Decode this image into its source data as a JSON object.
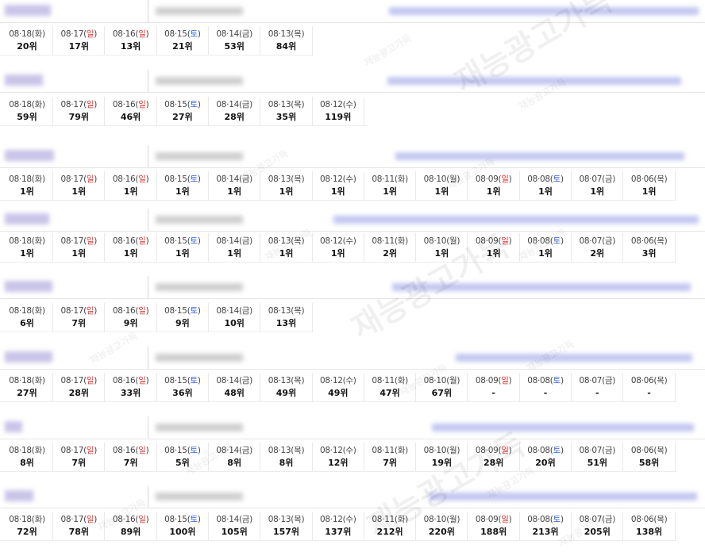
{
  "colors": {
    "sunday": "#e0302d",
    "saturday": "#2f5fd0",
    "watermark": "#bdbdbd"
  },
  "watermark_text": "재능광고가득",
  "blocks": [
    {
      "cells": [
        {
          "md": "08·18",
          "wd": "화",
          "rank": "20위"
        },
        {
          "md": "08·17",
          "wd": "일",
          "rank": "17위"
        },
        {
          "md": "08·16",
          "wd": "일",
          "rank": "13위"
        },
        {
          "md": "08·15",
          "wd": "토",
          "rank": "21위"
        },
        {
          "md": "08·14",
          "wd": "금",
          "rank": "53위"
        },
        {
          "md": "08·13",
          "wd": "목",
          "rank": "84위"
        }
      ]
    },
    {
      "cells": [
        {
          "md": "08·18",
          "wd": "화",
          "rank": "59위"
        },
        {
          "md": "08·17",
          "wd": "일",
          "rank": "79위"
        },
        {
          "md": "08·16",
          "wd": "일",
          "rank": "46위"
        },
        {
          "md": "08·15",
          "wd": "토",
          "rank": "27위"
        },
        {
          "md": "08·14",
          "wd": "금",
          "rank": "28위"
        },
        {
          "md": "08·13",
          "wd": "목",
          "rank": "35위"
        },
        {
          "md": "08·12",
          "wd": "수",
          "rank": "119위"
        }
      ]
    },
    {
      "cells": [
        {
          "md": "08·18",
          "wd": "화",
          "rank": "1위"
        },
        {
          "md": "08·17",
          "wd": "일",
          "rank": "1위"
        },
        {
          "md": "08·16",
          "wd": "일",
          "rank": "1위"
        },
        {
          "md": "08·15",
          "wd": "토",
          "rank": "1위"
        },
        {
          "md": "08·14",
          "wd": "금",
          "rank": "1위"
        },
        {
          "md": "08·13",
          "wd": "목",
          "rank": "1위"
        },
        {
          "md": "08·12",
          "wd": "수",
          "rank": "1위"
        },
        {
          "md": "08·11",
          "wd": "화",
          "rank": "1위"
        },
        {
          "md": "08·10",
          "wd": "월",
          "rank": "1위"
        },
        {
          "md": "08·09",
          "wd": "일",
          "rank": "1위"
        },
        {
          "md": "08·08",
          "wd": "토",
          "rank": "1위"
        },
        {
          "md": "08·07",
          "wd": "금",
          "rank": "1위"
        },
        {
          "md": "08·06",
          "wd": "목",
          "rank": "1위"
        }
      ]
    },
    {
      "cells": [
        {
          "md": "08·18",
          "wd": "화",
          "rank": "1위"
        },
        {
          "md": "08·17",
          "wd": "일",
          "rank": "1위"
        },
        {
          "md": "08·16",
          "wd": "일",
          "rank": "1위"
        },
        {
          "md": "08·15",
          "wd": "토",
          "rank": "1위"
        },
        {
          "md": "08·14",
          "wd": "금",
          "rank": "1위"
        },
        {
          "md": "08·13",
          "wd": "목",
          "rank": "1위"
        },
        {
          "md": "08·12",
          "wd": "수",
          "rank": "1위"
        },
        {
          "md": "08·11",
          "wd": "화",
          "rank": "2위"
        },
        {
          "md": "08·10",
          "wd": "월",
          "rank": "1위"
        },
        {
          "md": "08·09",
          "wd": "일",
          "rank": "1위"
        },
        {
          "md": "08·08",
          "wd": "토",
          "rank": "1위"
        },
        {
          "md": "08·07",
          "wd": "금",
          "rank": "2위"
        },
        {
          "md": "08·06",
          "wd": "목",
          "rank": "3위"
        }
      ]
    },
    {
      "cells": [
        {
          "md": "08·18",
          "wd": "화",
          "rank": "6위"
        },
        {
          "md": "08·17",
          "wd": "일",
          "rank": "7위"
        },
        {
          "md": "08·16",
          "wd": "일",
          "rank": "9위"
        },
        {
          "md": "08·15",
          "wd": "토",
          "rank": "9위"
        },
        {
          "md": "08·14",
          "wd": "금",
          "rank": "10위"
        },
        {
          "md": "08·13",
          "wd": "목",
          "rank": "13위"
        }
      ]
    },
    {
      "cells": [
        {
          "md": "08·18",
          "wd": "화",
          "rank": "27위"
        },
        {
          "md": "08·17",
          "wd": "일",
          "rank": "28위"
        },
        {
          "md": "08·16",
          "wd": "일",
          "rank": "33위"
        },
        {
          "md": "08·15",
          "wd": "토",
          "rank": "36위"
        },
        {
          "md": "08·14",
          "wd": "금",
          "rank": "48위"
        },
        {
          "md": "08·13",
          "wd": "목",
          "rank": "49위"
        },
        {
          "md": "08·12",
          "wd": "수",
          "rank": "49위"
        },
        {
          "md": "08·11",
          "wd": "화",
          "rank": "47위"
        },
        {
          "md": "08·10",
          "wd": "월",
          "rank": "67위"
        },
        {
          "md": "08·09",
          "wd": "일",
          "rank": "-"
        },
        {
          "md": "08·08",
          "wd": "토",
          "rank": "-"
        },
        {
          "md": "08·07",
          "wd": "금",
          "rank": "-"
        },
        {
          "md": "08·06",
          "wd": "목",
          "rank": "-"
        }
      ]
    },
    {
      "cells": [
        {
          "md": "08·18",
          "wd": "화",
          "rank": "8위"
        },
        {
          "md": "08·17",
          "wd": "일",
          "rank": "7위"
        },
        {
          "md": "08·16",
          "wd": "일",
          "rank": "7위"
        },
        {
          "md": "08·15",
          "wd": "토",
          "rank": "5위"
        },
        {
          "md": "08·14",
          "wd": "금",
          "rank": "8위"
        },
        {
          "md": "08·13",
          "wd": "목",
          "rank": "8위"
        },
        {
          "md": "08·12",
          "wd": "수",
          "rank": "12위"
        },
        {
          "md": "08·11",
          "wd": "화",
          "rank": "7위"
        },
        {
          "md": "08·10",
          "wd": "월",
          "rank": "19위"
        },
        {
          "md": "08·09",
          "wd": "일",
          "rank": "28위"
        },
        {
          "md": "08·08",
          "wd": "토",
          "rank": "20위"
        },
        {
          "md": "08·07",
          "wd": "금",
          "rank": "51위"
        },
        {
          "md": "08·06",
          "wd": "목",
          "rank": "58위"
        }
      ]
    },
    {
      "cells": [
        {
          "md": "08·18",
          "wd": "화",
          "rank": "72위"
        },
        {
          "md": "08·17",
          "wd": "일",
          "rank": "78위"
        },
        {
          "md": "08·16",
          "wd": "일",
          "rank": "89위"
        },
        {
          "md": "08·15",
          "wd": "토",
          "rank": "100위"
        },
        {
          "md": "08·14",
          "wd": "금",
          "rank": "105위"
        },
        {
          "md": "08·13",
          "wd": "목",
          "rank": "157위"
        },
        {
          "md": "08·12",
          "wd": "수",
          "rank": "137위"
        },
        {
          "md": "08·11",
          "wd": "화",
          "rank": "212위"
        },
        {
          "md": "08·10",
          "wd": "월",
          "rank": "220위"
        },
        {
          "md": "08·09",
          "wd": "일",
          "rank": "188위"
        },
        {
          "md": "08·08",
          "wd": "토",
          "rank": "213위"
        },
        {
          "md": "08·07",
          "wd": "금",
          "rank": "205위"
        },
        {
          "md": "08·06",
          "wd": "목",
          "rank": "138위"
        }
      ]
    }
  ]
}
